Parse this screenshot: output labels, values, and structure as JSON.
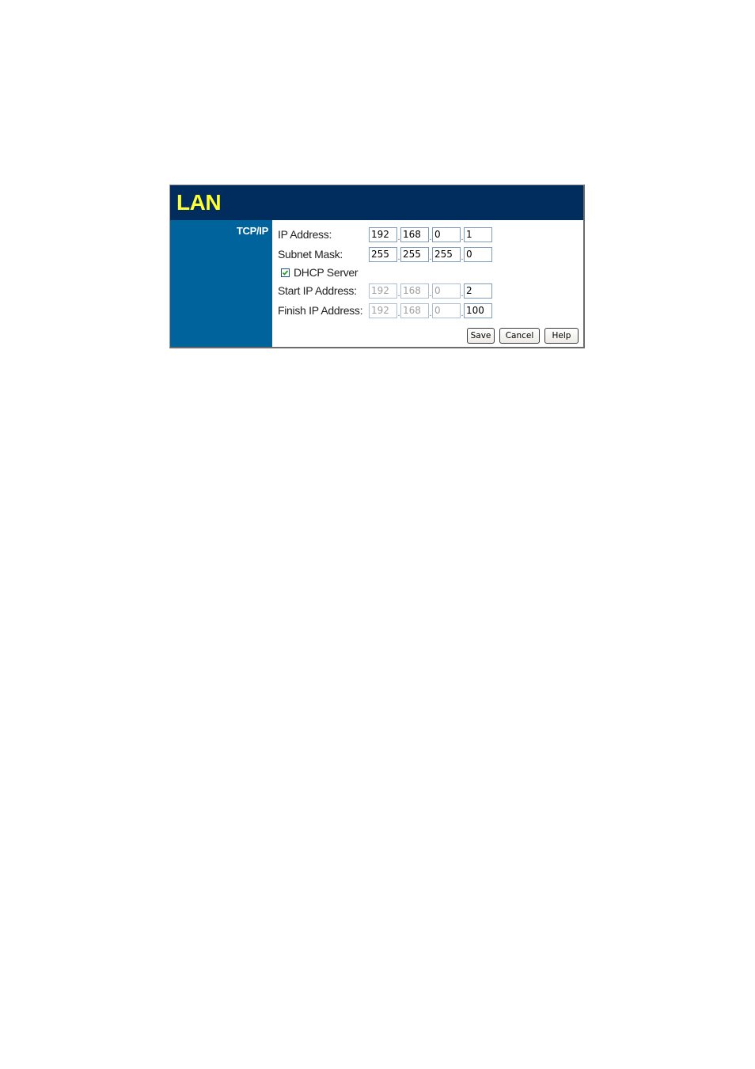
{
  "header": {
    "title": "LAN"
  },
  "sidebar": {
    "section_label": "TCP/IP"
  },
  "form": {
    "ip_address": {
      "label": "IP Address:",
      "octets": [
        "192",
        "168",
        "0",
        "1"
      ],
      "disabled": [
        false,
        false,
        false,
        false
      ]
    },
    "subnet_mask": {
      "label": "Subnet Mask:",
      "octets": [
        "255",
        "255",
        "255",
        "0"
      ],
      "disabled": [
        false,
        false,
        false,
        false
      ]
    },
    "dhcp_server": {
      "label": "DHCP Server",
      "checked": true
    },
    "start_ip": {
      "label": "Start IP Address:",
      "octets": [
        "192",
        "168",
        "0",
        "2"
      ],
      "disabled": [
        true,
        true,
        true,
        false
      ]
    },
    "finish_ip": {
      "label": "Finish IP Address:",
      "octets": [
        "192",
        "168",
        "0",
        "100"
      ],
      "disabled": [
        true,
        true,
        true,
        false
      ]
    },
    "separator": "."
  },
  "buttons": {
    "save": "Save",
    "cancel": "Cancel",
    "help": "Help"
  },
  "colors": {
    "header_bg": "#002d5e",
    "title_color": "#ffff33",
    "sidebar_bg": "#00639c",
    "input_border": "#7f9db9",
    "checkmark": "#21a121"
  }
}
